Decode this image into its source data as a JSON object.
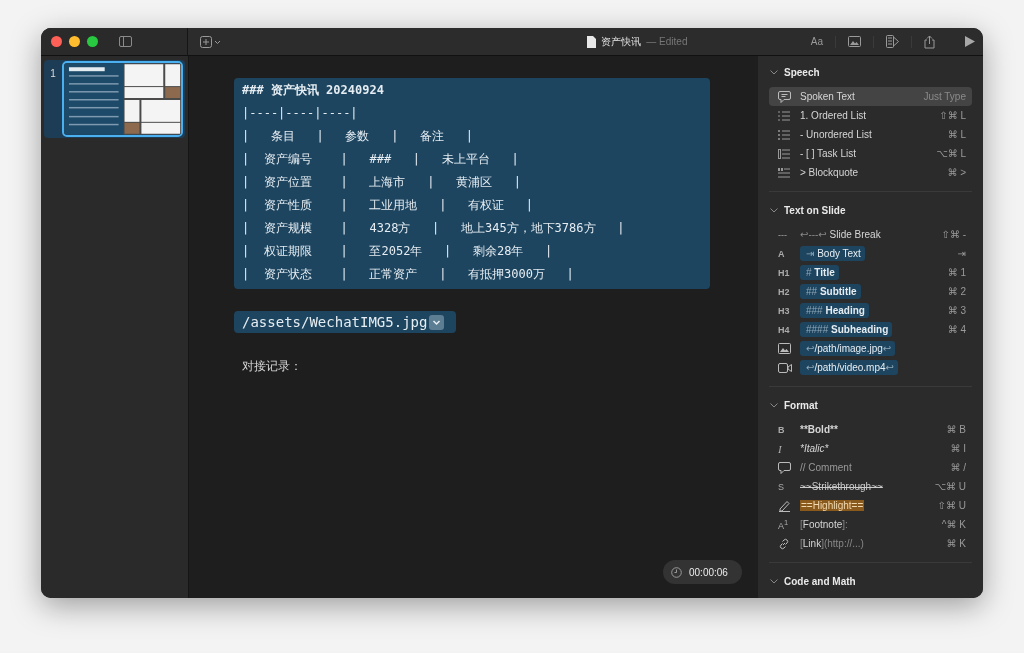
{
  "window": {
    "title": "资产快讯",
    "status": "— Edited"
  },
  "toolbar": {
    "font_button": "Aa"
  },
  "slides": [
    {
      "number": "1",
      "selected": true
    }
  ],
  "editor": {
    "code_lines": [
      {
        "kind": "heading",
        "text": "### 资产快讯 20240924"
      },
      {
        "kind": "line",
        "text": "|----|----|----|"
      },
      {
        "kind": "line",
        "text": "|   条目   |   参数   |   备注   |"
      },
      {
        "kind": "line",
        "text": "|  资产编号    |   ###   |   未上平台   |"
      },
      {
        "kind": "line",
        "text": "|  资产位置    |   上海市   |   黄浦区   |"
      },
      {
        "kind": "line",
        "text": "|  资产性质    |   工业用地   |   有权证   |"
      },
      {
        "kind": "line",
        "text": "|  资产规模    |   4328方   |   地上345方，地下3786方   |"
      },
      {
        "kind": "line",
        "text": "|  权证期限    |   至2052年   |   剩余28年   |"
      },
      {
        "kind": "line",
        "text": "|  资产状态    |   正常资产   |   有抵押3000万   |"
      }
    ],
    "image_ref": "/assets/WechatIMG5.jpg",
    "note": "对接记录：",
    "timer": "00:00:06"
  },
  "panel": {
    "sections": [
      {
        "title": "Speech",
        "items": [
          {
            "kind": "bubble",
            "label": "Spoken Text",
            "shortcut": "Just Type",
            "selected": true
          },
          {
            "kind": "ordered",
            "label": "1. Ordered List",
            "shortcut": "⇧⌘ L",
            "selected": false
          },
          {
            "kind": "bullets",
            "label": "- Unordered List",
            "shortcut": "⌘ L",
            "selected": false
          },
          {
            "kind": "tasks",
            "label": "- [ ] Task List",
            "shortcut": "⌥⌘ L",
            "selected": false
          },
          {
            "kind": "quote",
            "label": "> Blockquote",
            "shortcut": "⌘ >",
            "selected": false
          }
        ]
      },
      {
        "title": "Text on Slide",
        "items": [
          {
            "kind": "glyph",
            "glyph": "---",
            "prefix": "↩---↩",
            "label": "Slide Break",
            "shortcut": "⇧⌘ -",
            "selected": false
          },
          {
            "kind": "glyph",
            "glyph": "A",
            "prefix": "⇥",
            "label": "Body Text",
            "shortcut": "⇥",
            "selected": false
          },
          {
            "kind": "glyph",
            "glyph": "H1",
            "prefix": "#",
            "label": "Title",
            "shortcut": "⌘ 1",
            "selected": false
          },
          {
            "kind": "glyph",
            "glyph": "H2",
            "prefix": "##",
            "label": "Subtitle",
            "shortcut": "⌘ 2",
            "selected": false
          },
          {
            "kind": "glyph",
            "glyph": "H3",
            "prefix": "###",
            "label": "Heading",
            "shortcut": "⌘ 3",
            "selected": false
          },
          {
            "kind": "glyph",
            "glyph": "H4",
            "prefix": "####",
            "label": "Subheading",
            "shortcut": "⌘ 4",
            "selected": false
          },
          {
            "kind": "image",
            "prefix": "↩",
            "label": "/path/image.jpg",
            "suffix": "↩",
            "selected": false
          },
          {
            "kind": "video",
            "prefix": "↩",
            "label": "/path/video.mp4",
            "suffix": "↩",
            "selected": false
          }
        ]
      },
      {
        "title": "Format",
        "items": [
          {
            "kind": "glyph",
            "glyph": "B",
            "label": "**Bold**",
            "shortcut": "⌘ B",
            "selected": false
          },
          {
            "kind": "glyph",
            "glyph": "I",
            "label": "*Italic*",
            "shortcut": "⌘ I",
            "selected": false
          },
          {
            "kind": "comment",
            "label": "// Comment",
            "shortcut": "⌘ /",
            "selected": false
          },
          {
            "kind": "glyph",
            "glyph": "S",
            "label": "~~Strikethrough~~",
            "shortcut": "⌥⌘ U",
            "selected": false
          },
          {
            "kind": "pen",
            "label": "==Highlight==",
            "shortcut": "⇧⌘ U",
            "selected": false
          },
          {
            "kind": "glyph",
            "glyph": "A$^{1}$",
            "prefix": "[",
            "label": "Footnote",
            "suffix": "]:",
            "shortcut": "^⌘ K",
            "selected": false
          },
          {
            "kind": "link",
            "prefix": "[",
            "label": "Link",
            "suffix": "](http://...)",
            "shortcut": "⌘ K",
            "selected": false
          }
        ]
      },
      {
        "title": "Code and Math"
      }
    ]
  }
}
